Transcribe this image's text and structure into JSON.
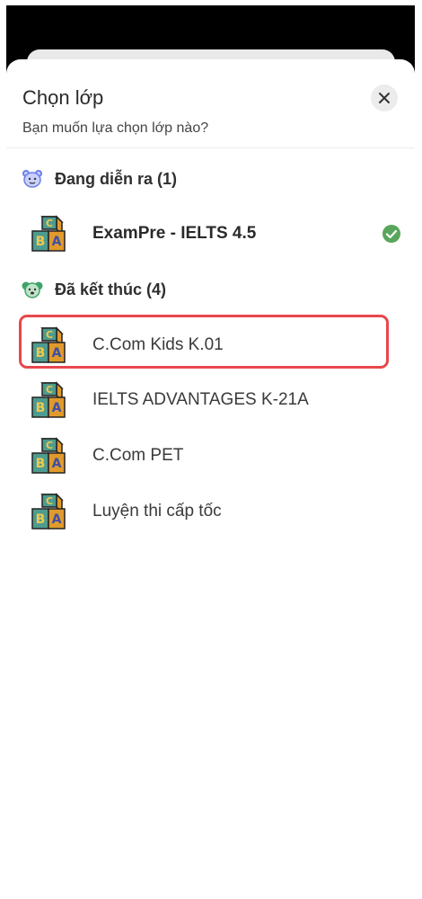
{
  "sheet": {
    "title": "Chọn lớp",
    "subtitle": "Bạn muốn lựa chọn lớp nào?",
    "close_icon": "close-icon"
  },
  "sections": [
    {
      "label": "Đang diễn ra (1)",
      "icon": "bear-face-icon",
      "icon_color": "#6d7fe6",
      "items": [
        {
          "name": "ExamPre - IELTS 4.5",
          "active": true,
          "checked": true
        }
      ]
    },
    {
      "label": "Đã kết thúc (4)",
      "icon": "koala-face-icon",
      "icon_color": "#3fa36b",
      "items": [
        {
          "name": "C.Com Kids K.01",
          "highlighted": true
        },
        {
          "name": "IELTS ADVANTAGES K-21A"
        },
        {
          "name": "C.Com PET"
        },
        {
          "name": "Luyện thi cấp tốc"
        }
      ]
    }
  ],
  "colors": {
    "check": "#58a65c",
    "highlight": "#e8474c"
  }
}
